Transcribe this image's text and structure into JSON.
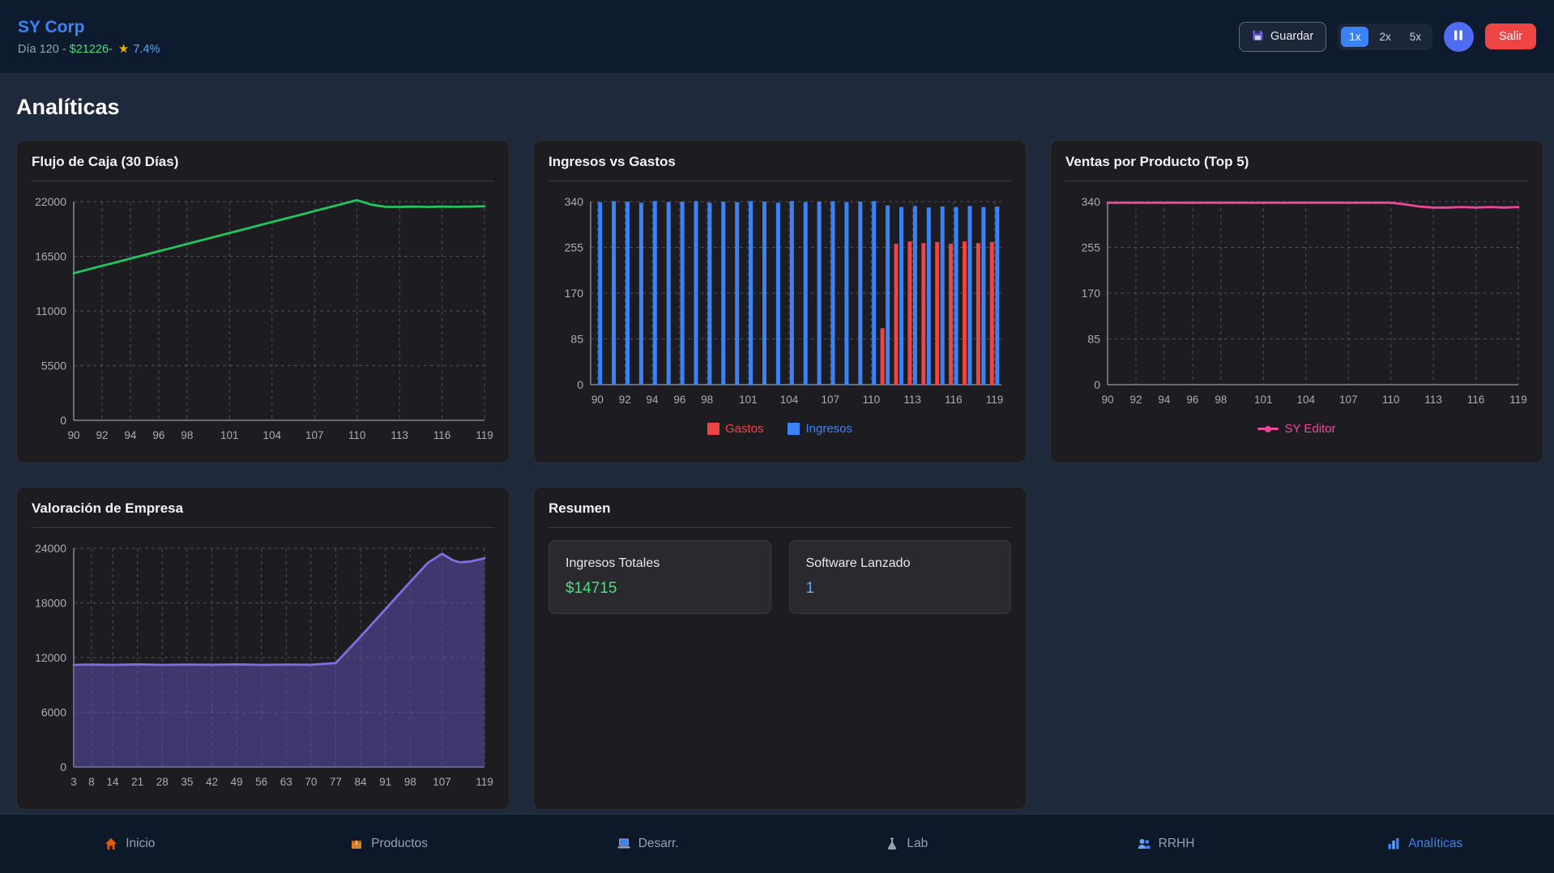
{
  "header": {
    "company": "SY Corp",
    "day_label": "Día 120 - ",
    "cash": "$21226",
    "separator": "-",
    "star_icon": "★",
    "rating": "7.4%",
    "save_button": "Guardar",
    "save_icon": "floppy-disk-icon",
    "speed_options": [
      "1x",
      "2x",
      "5x"
    ],
    "active_speed": "1x",
    "pause_icon": "pause-icon",
    "exit_button": "Salir"
  },
  "page_title": "Analíticas",
  "summary": {
    "title": "Resumen",
    "stats": [
      {
        "label": "Ingresos Totales",
        "value": "$14715",
        "color": "#4ade80"
      },
      {
        "label": "Software Lanzado",
        "value": "1",
        "color": "#60a5fa"
      }
    ]
  },
  "nav": {
    "items": [
      {
        "label": "Inicio",
        "icon": "house-icon",
        "active": false
      },
      {
        "label": "Productos",
        "icon": "package-icon",
        "active": false
      },
      {
        "label": "Desarr.",
        "icon": "laptop-icon",
        "active": false
      },
      {
        "label": "Lab",
        "icon": "flask-icon",
        "active": false
      },
      {
        "label": "RRHH",
        "icon": "users-icon",
        "active": false
      },
      {
        "label": "Analíticas",
        "icon": "bar-chart-icon",
        "active": true
      }
    ]
  },
  "chart_data": [
    {
      "id": "flujo-caja",
      "type": "line",
      "title": "Flujo de Caja (30 Días)",
      "color": "#22c55e",
      "x": [
        90,
        91,
        92,
        93,
        94,
        95,
        96,
        97,
        98,
        99,
        100,
        101,
        102,
        103,
        104,
        105,
        106,
        107,
        108,
        109,
        110,
        111,
        112,
        113,
        114,
        115,
        116,
        117,
        118,
        119
      ],
      "values": [
        14800,
        15170,
        15540,
        15900,
        16270,
        16640,
        17010,
        17370,
        17740,
        18110,
        18480,
        18840,
        19210,
        19580,
        19950,
        20310,
        20680,
        21050,
        21420,
        21780,
        22150,
        21700,
        21480,
        21470,
        21500,
        21470,
        21500,
        21480,
        21500,
        21530
      ],
      "x_ticks": [
        90,
        92,
        94,
        96,
        98,
        101,
        104,
        107,
        110,
        113,
        116,
        119
      ],
      "y_ticks": [
        0,
        5500,
        11000,
        16500,
        22000
      ],
      "ylim": [
        0,
        22000
      ],
      "grid": "dashed",
      "legend_position": "none"
    },
    {
      "id": "ingresos-gastos",
      "type": "bar",
      "title": "Ingresos vs Gastos",
      "x": [
        90,
        91,
        92,
        93,
        94,
        95,
        96,
        97,
        98,
        99,
        100,
        101,
        102,
        103,
        104,
        105,
        106,
        107,
        108,
        109,
        110,
        111,
        112,
        113,
        114,
        115,
        116,
        117,
        118,
        119
      ],
      "series": [
        {
          "name": "Gastos",
          "color": "#ef4444",
          "values": [
            0,
            0,
            0,
            0,
            0,
            0,
            0,
            0,
            0,
            0,
            0,
            0,
            0,
            0,
            0,
            0,
            0,
            0,
            0,
            0,
            0,
            105,
            262,
            266,
            263,
            265,
            262,
            266,
            263,
            265
          ]
        },
        {
          "name": "Ingresos",
          "color": "#3b82f6",
          "values": [
            339,
            341,
            340,
            338,
            341,
            339,
            340,
            341,
            338,
            340,
            339,
            341,
            340,
            338,
            341,
            339,
            340,
            341,
            339,
            340,
            341,
            333,
            330,
            332,
            329,
            331,
            330,
            332,
            330,
            331
          ]
        }
      ],
      "x_ticks": [
        90,
        92,
        94,
        96,
        98,
        101,
        104,
        107,
        110,
        113,
        116,
        119
      ],
      "y_ticks": [
        0,
        85,
        170,
        255,
        340
      ],
      "ylim": [
        0,
        340
      ],
      "grid": "dashed",
      "legend_position": "bottom"
    },
    {
      "id": "ventas-producto",
      "type": "line",
      "title": "Ventas por Producto (Top 5)",
      "series": [
        {
          "name": "SY Editor",
          "color": "#ec4899",
          "values": [
            338,
            338,
            338,
            338,
            338,
            338,
            338,
            338,
            338,
            338,
            338,
            338,
            338,
            338,
            338,
            338,
            338,
            338,
            338,
            338,
            338,
            335,
            331,
            329,
            329,
            330,
            329,
            330,
            329,
            330
          ]
        }
      ],
      "x": [
        90,
        91,
        92,
        93,
        94,
        95,
        96,
        97,
        98,
        99,
        100,
        101,
        102,
        103,
        104,
        105,
        106,
        107,
        108,
        109,
        110,
        111,
        112,
        113,
        114,
        115,
        116,
        117,
        118,
        119
      ],
      "x_ticks": [
        90,
        92,
        94,
        96,
        98,
        101,
        104,
        107,
        110,
        113,
        116,
        119
      ],
      "y_ticks": [
        0,
        85,
        170,
        255,
        340
      ],
      "ylim": [
        0,
        340
      ],
      "grid": "dashed",
      "legend_position": "bottom"
    },
    {
      "id": "valoracion-empresa",
      "type": "area",
      "title": "Valoración de Empresa",
      "color": "#7c6fdf",
      "fill": "#5b4fae",
      "x": [
        3,
        8,
        14,
        21,
        28,
        35,
        42,
        49,
        56,
        63,
        70,
        77,
        84,
        91,
        98,
        103,
        107,
        110,
        112,
        115,
        119
      ],
      "values": [
        11200,
        11230,
        11200,
        11250,
        11200,
        11230,
        11210,
        11250,
        11200,
        11230,
        11210,
        11400,
        14300,
        17300,
        20300,
        22400,
        23400,
        22700,
        22450,
        22550,
        22900
      ],
      "x_ticks": [
        3,
        8,
        14,
        21,
        28,
        35,
        42,
        49,
        56,
        63,
        70,
        77,
        84,
        91,
        98,
        107,
        119
      ],
      "y_ticks": [
        0,
        6000,
        12000,
        18000,
        24000
      ],
      "ylim": [
        0,
        24000
      ],
      "grid": "dashed",
      "legend_position": "none"
    }
  ]
}
